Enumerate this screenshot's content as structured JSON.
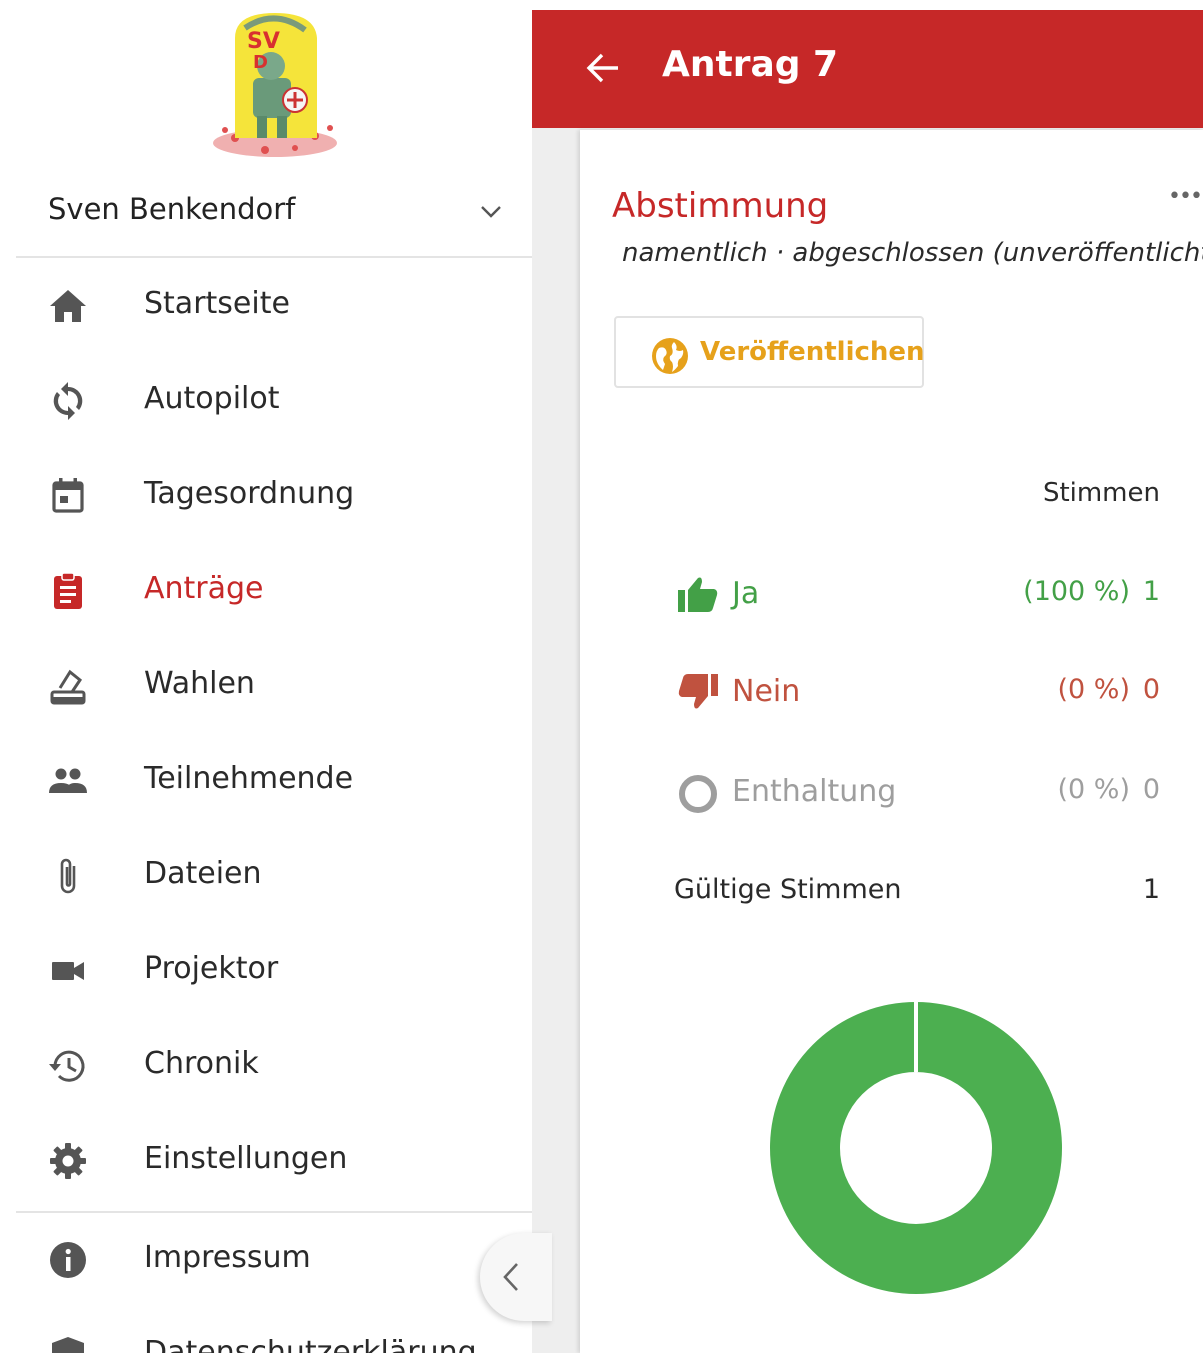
{
  "user": {
    "name": "Sven Benkendorf"
  },
  "nav": {
    "items": [
      {
        "label": "Startseite",
        "icon": "home-icon"
      },
      {
        "label": "Autopilot",
        "icon": "sync-icon"
      },
      {
        "label": "Tagesordnung",
        "icon": "calendar-icon"
      },
      {
        "label": "Anträge",
        "icon": "clipboard-icon",
        "active": true
      },
      {
        "label": "Wahlen",
        "icon": "ballot-icon"
      },
      {
        "label": "Teilnehmende",
        "icon": "people-icon"
      },
      {
        "label": "Dateien",
        "icon": "paperclip-icon"
      },
      {
        "label": "Projektor",
        "icon": "videocam-icon"
      },
      {
        "label": "Chronik",
        "icon": "history-icon"
      },
      {
        "label": "Einstellungen",
        "icon": "gear-icon"
      }
    ],
    "secondary": [
      {
        "label": "Impressum",
        "icon": "info-icon"
      },
      {
        "label": "Datenschutzerklärung",
        "icon": "shield-icon"
      }
    ]
  },
  "header": {
    "title": "Antrag 7"
  },
  "poll": {
    "title": "Abstimmung",
    "subtitle": "namentlich · abgeschlossen (unveröffentlicht)",
    "publish_label": "Veröffentlichen",
    "column_header": "Stimmen",
    "options": [
      {
        "label": "Ja",
        "percent": "(100 %)",
        "count": "1",
        "color": "#43a047",
        "icon": "thumbs-up-icon"
      },
      {
        "label": "Nein",
        "percent": "(0 %)",
        "count": "0",
        "color": "#c0523f",
        "icon": "thumbs-down-icon"
      },
      {
        "label": "Enthaltung",
        "percent": "(0 %)",
        "count": "0",
        "color": "#9e9e9e",
        "icon": "circle-outline-icon"
      }
    ],
    "valid_label": "Gültige Stimmen",
    "valid_count": "1"
  },
  "chart_data": {
    "type": "pie",
    "categories": [
      "Ja",
      "Nein",
      "Enthaltung"
    ],
    "values": [
      1,
      0,
      0
    ],
    "colors": [
      "#4caf50",
      "#c0523f",
      "#9e9e9e"
    ]
  },
  "colors": {
    "accent": "#c62828",
    "publish": "#e6a11b",
    "yes": "#43a047"
  }
}
